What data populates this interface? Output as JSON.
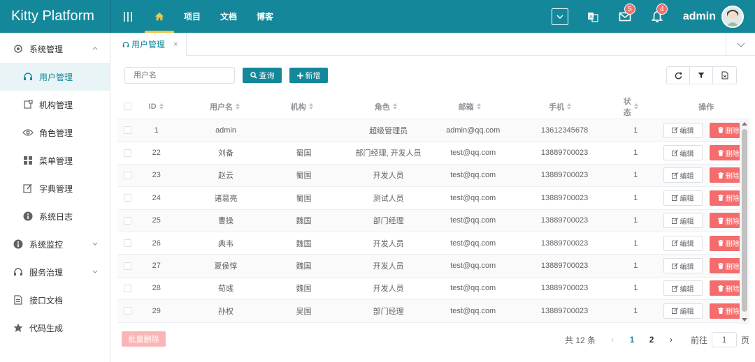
{
  "app": {
    "title": "Kitty Platform"
  },
  "topnav": {
    "items": [
      {
        "label": "项目"
      },
      {
        "label": "文档"
      },
      {
        "label": "博客"
      }
    ],
    "messages_badge": "5",
    "notifications_badge": "4",
    "user_name": "admin"
  },
  "sidebar": {
    "items": [
      {
        "label": "系统管理",
        "icon": "gear-icon",
        "expanded": true
      },
      {
        "label": "用户管理",
        "icon": "headset-icon",
        "active": true
      },
      {
        "label": "机构管理",
        "icon": "org-icon"
      },
      {
        "label": "角色管理",
        "icon": "eye-icon"
      },
      {
        "label": "菜单管理",
        "icon": "grid-icon"
      },
      {
        "label": "字典管理",
        "icon": "edit-icon"
      },
      {
        "label": "系统日志",
        "icon": "info-icon"
      },
      {
        "label": "系统监控",
        "icon": "info-icon"
      },
      {
        "label": "服务治理",
        "icon": "headset-icon"
      },
      {
        "label": "接口文档",
        "icon": "document-icon"
      },
      {
        "label": "代码生成",
        "icon": "star-icon"
      }
    ]
  },
  "tabs": [
    {
      "label": "用户管理",
      "close": "×"
    }
  ],
  "toolbar": {
    "search_placeholder": "用户名",
    "query_label": "查询",
    "add_label": "新增"
  },
  "table": {
    "headers": [
      "ID",
      "用户名",
      "机构",
      "角色",
      "邮箱",
      "手机",
      "状态",
      "操作"
    ],
    "edit_label": "编辑",
    "delete_label": "删除",
    "rows": [
      {
        "id": "1",
        "name": "admin",
        "org": "",
        "role": "超级管理员",
        "email": "admin@qq.com",
        "phone": "13612345678",
        "status": "1"
      },
      {
        "id": "22",
        "name": "刘备",
        "org": "蜀国",
        "role": "部门经理, 开发人员",
        "email": "test@qq.com",
        "phone": "13889700023",
        "status": "1"
      },
      {
        "id": "23",
        "name": "赵云",
        "org": "蜀国",
        "role": "开发人员",
        "email": "test@qq.com",
        "phone": "13889700023",
        "status": "1"
      },
      {
        "id": "24",
        "name": "诸葛亮",
        "org": "蜀国",
        "role": "测试人员",
        "email": "test@qq.com",
        "phone": "13889700023",
        "status": "1"
      },
      {
        "id": "25",
        "name": "曹操",
        "org": "魏国",
        "role": "部门经理",
        "email": "test@qq.com",
        "phone": "13889700023",
        "status": "1"
      },
      {
        "id": "26",
        "name": "典韦",
        "org": "魏国",
        "role": "开发人员",
        "email": "test@qq.com",
        "phone": "13889700023",
        "status": "1"
      },
      {
        "id": "27",
        "name": "夏侯惇",
        "org": "魏国",
        "role": "开发人员",
        "email": "test@qq.com",
        "phone": "13889700023",
        "status": "1"
      },
      {
        "id": "28",
        "name": "荀彧",
        "org": "魏国",
        "role": "开发人员",
        "email": "test@qq.com",
        "phone": "13889700023",
        "status": "1"
      },
      {
        "id": "29",
        "name": "孙权",
        "org": "吴国",
        "role": "部门经理",
        "email": "test@qq.com",
        "phone": "13889700023",
        "status": "1"
      }
    ]
  },
  "footer": {
    "batch_delete_label": "批量删除",
    "total_text": "共 12 条",
    "pages": [
      "1",
      "2"
    ],
    "current_page": "1",
    "goto_prefix": "前往",
    "goto_value": "1",
    "goto_suffix": "页"
  },
  "colors": {
    "primary": "#14889a",
    "danger": "#f56c6c",
    "accent": "#f6c343"
  }
}
